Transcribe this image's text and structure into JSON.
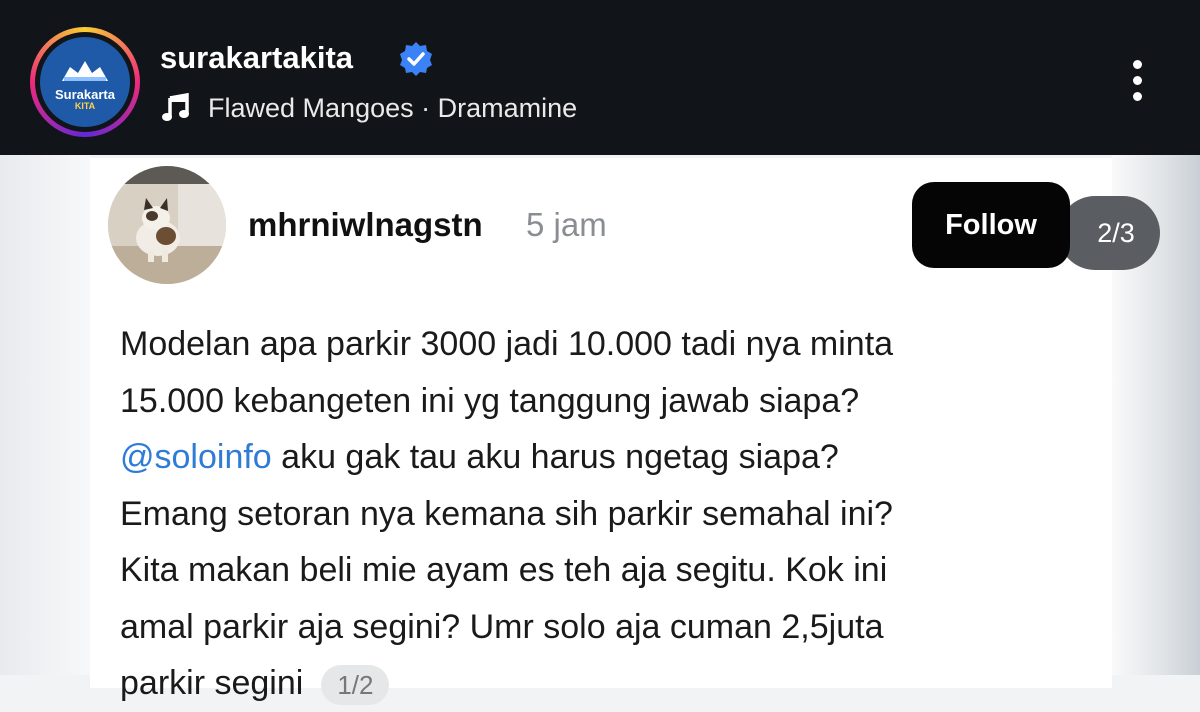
{
  "header": {
    "account_name": "surakartakita",
    "verified": true,
    "audio": "Flawed Mangoes · Dramamine",
    "logo_text": "Surakarta",
    "logo_subtext": "KITA",
    "icons": [
      "verified-badge-icon",
      "music-note-icon",
      "more-options-icon"
    ]
  },
  "post": {
    "username": "mhrniwlnagstn",
    "time": "5 jam",
    "follow_label": "Follow",
    "page_counter": "2/3",
    "text": {
      "line1": "Modelan apa parkir 3000 jadi 10.000 tadi nya minta",
      "line2": "15.000 kebangeten ini yg tanggung jawab siapa?",
      "mention": "@soloinfo",
      "line3_rest": " aku gak tau aku harus ngetag siapa?",
      "line4": "Emang setoran nya kemana sih parkir semahal ini?",
      "line5": "Kita makan beli mie ayam es teh aja segitu. Kok ini",
      "line6": "amal parkir aja segini? Umr solo aja cuman 2,5juta",
      "line7": "parkir segini",
      "thread_badge": "1/2"
    }
  },
  "colors": {
    "header_bg": "#111418",
    "verified_blue": "#3b82f6",
    "mention_blue": "#2f7bd6",
    "follow_bg": "#050505"
  }
}
